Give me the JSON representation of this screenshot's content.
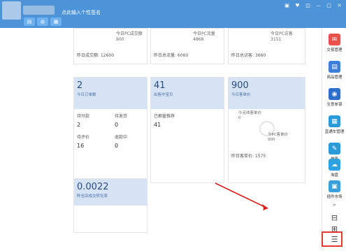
{
  "window": {
    "signature": "点此输入个性签名",
    "controls": [
      "▣",
      "♥",
      "◫",
      "—",
      "□",
      "✕"
    ]
  },
  "titlebar": {
    "buttons": [
      "▤",
      "◍",
      "▦"
    ]
  },
  "stats_top": {
    "card1": {
      "today_label": "今日PC成交额",
      "today_value": "900",
      "yesterday": "昨日成交额: 12600"
    },
    "card2": {
      "today_label": "今日PC流量",
      "today_value": "4868",
      "yesterday": "昨日总流量: 6060"
    },
    "card3": {
      "today_label": "今日PC访客",
      "today_value": "3151",
      "yesterday": "昨日总访客: 3660"
    }
  },
  "orders": {
    "value": "2",
    "label": "今日订单数",
    "cells": [
      {
        "label": "待付款",
        "value": "2"
      },
      {
        "label": "待发货",
        "value": "0"
      },
      {
        "label": "待评价",
        "value": "16"
      },
      {
        "label": "退款中",
        "value": "0"
      }
    ]
  },
  "recommend": {
    "value": "41",
    "label": "出售中宝贝",
    "item_label": "已橱窗推荐",
    "item_value": "41"
  },
  "avg_price": {
    "value": "900",
    "label": "今日客单价",
    "wireless_label": "今无线客单价",
    "wireless_value": "0",
    "pc_label": "今PC客单价",
    "pc_value": "900",
    "yesterday": "昨日客单价: 1575"
  },
  "conversion": {
    "value": "0.0022",
    "label": "昨全店成交转化率"
  },
  "sidebar": {
    "items": [
      {
        "label": "交易管理",
        "icon": "✉",
        "color": "#e8524a"
      },
      {
        "label": "商品管理",
        "icon": "▤",
        "color": "#3f7ed6"
      },
      {
        "label": "生意参谋",
        "icon": "◉",
        "color": "#2c6fcb"
      },
      {
        "label": "直通车管理",
        "icon": "▦",
        "color": "#2a9ad8"
      },
      {
        "label": "神笔",
        "icon": "✎",
        "color": "#2a9ad8"
      },
      {
        "label": "淘盘",
        "icon": "☁",
        "color": "#2aa3e0"
      },
      {
        "label": "插件市场",
        "icon": "▣",
        "color": "#3aa0dc"
      }
    ],
    "scroll_down": "⌄",
    "bottom_icons": [
      "⊟",
      "⊞",
      "☰"
    ]
  }
}
